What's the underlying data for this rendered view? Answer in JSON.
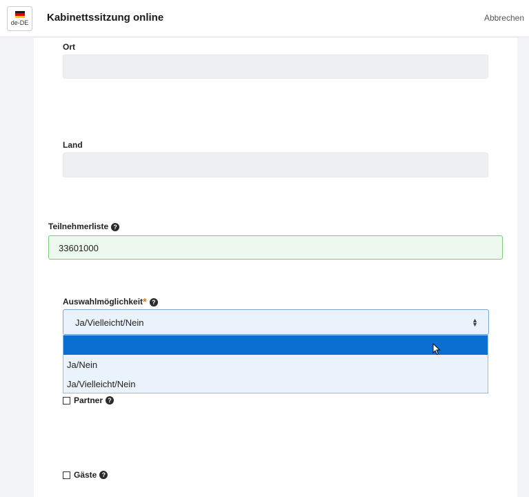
{
  "header": {
    "lang_code": "de-DE",
    "flag_colors": [
      "#1a1a1a",
      "#dd0000",
      "#ffce00"
    ],
    "title": "Kabinettssitzung online",
    "cancel_label": "Abbrechen"
  },
  "form": {
    "ort": {
      "label": "Ort",
      "value": ""
    },
    "land": {
      "label": "Land",
      "value": ""
    },
    "teilnehmerliste": {
      "label": "Teilnehmerliste",
      "value": "33601000"
    },
    "auswahl": {
      "label": "Auswahlmöglichkeit",
      "required_marker": "*",
      "value": "Ja/Vielleicht/Nein",
      "options": [
        "",
        "Ja/Nein",
        "Ja/Vielleicht/Nein"
      ]
    },
    "partner": {
      "label": "Partner",
      "checked": false
    },
    "gaeste": {
      "label": "Gäste",
      "checked": false
    }
  },
  "icons": {
    "help": "question-circle-icon",
    "cursor": "mouse-pointer-icon"
  },
  "colors": {
    "accent_blue": "#0a6fd1",
    "valid_green": "#7cc87f",
    "required_orange": "#d8791a"
  }
}
